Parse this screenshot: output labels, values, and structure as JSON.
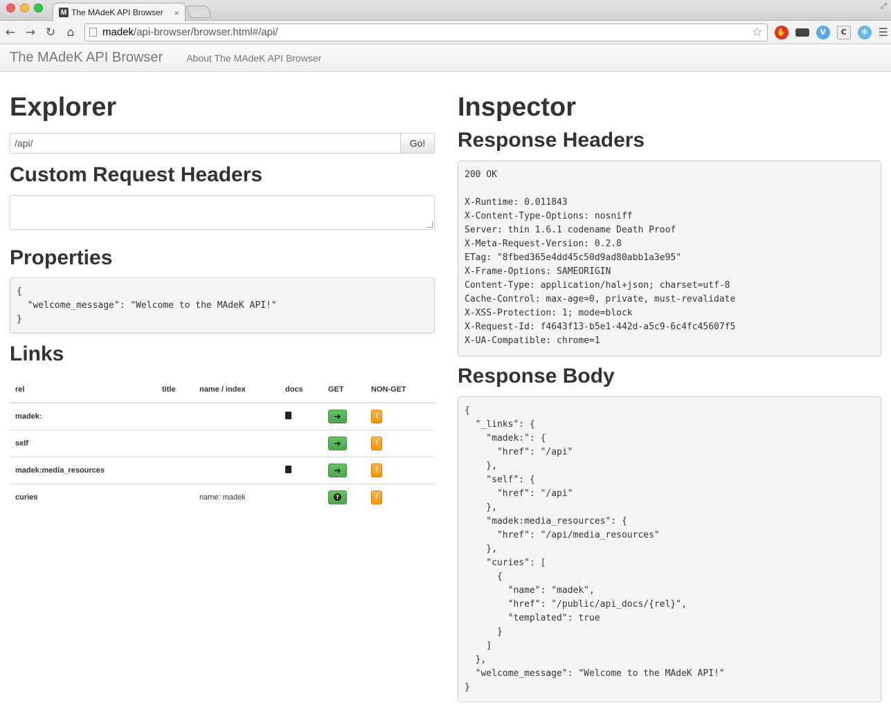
{
  "browser": {
    "tab_title": "The MAdeK API Browser",
    "tab_favicon": "M",
    "tab_close": "×",
    "url_host": "madek",
    "url_path": "/api-browser/browser.html#/api/"
  },
  "navbar": {
    "brand": "The MAdeK API Browser",
    "about_link": "About The MAdeK API Browser"
  },
  "explorer": {
    "title": "Explorer",
    "url_value": "/api/",
    "go_label": "Go!",
    "custom_headers_title": "Custom Request Headers",
    "custom_headers_value": "",
    "properties_title": "Properties",
    "properties_json": "{\n  \"welcome_message\": \"Welcome to the MAdeK API!\"\n}",
    "links_title": "Links",
    "links_table": {
      "headers": [
        "rel",
        "title",
        "name / index",
        "docs",
        "GET",
        "NON-GET"
      ],
      "rows": [
        {
          "rel": "madek:",
          "title": "",
          "name": "",
          "docs": true,
          "get_icon": "arrow-right-icon",
          "nonget_icon": "exclamation-icon"
        },
        {
          "rel": "self",
          "title": "",
          "name": "",
          "docs": false,
          "get_icon": "arrow-right-icon",
          "nonget_icon": "exclamation-icon"
        },
        {
          "rel": "madek:media_resources",
          "title": "",
          "name": "",
          "docs": true,
          "get_icon": "arrow-right-icon",
          "nonget_icon": "exclamation-icon"
        },
        {
          "rel": "curies",
          "title": "",
          "name": "name: madek",
          "docs": false,
          "get_icon": "question-icon",
          "nonget_icon": "exclamation-icon"
        }
      ]
    }
  },
  "inspector": {
    "title": "Inspector",
    "response_headers_title": "Response Headers",
    "response_headers": "200 OK\n\nX-Runtime: 0.011843\nX-Content-Type-Options: nosniff\nServer: thin 1.6.1 codename Death Proof\nX-Meta-Request-Version: 0.2.8\nETag: \"8fbed365e4dd45c50d9ad80abb1a3e95\"\nX-Frame-Options: SAMEORIGIN\nContent-Type: application/hal+json; charset=utf-8\nCache-Control: max-age=0, private, must-revalidate\nX-XSS-Protection: 1; mode=block\nX-Request-Id: f4643f13-b5e1-442d-a5c9-6c4fc45607f5\nX-UA-Compatible: chrome=1",
    "response_body_title": "Response Body",
    "response_body": "{\n  \"_links\": {\n    \"madek:\": {\n      \"href\": \"/api\"\n    },\n    \"self\": {\n      \"href\": \"/api\"\n    },\n    \"madek:media_resources\": {\n      \"href\": \"/api/media_resources\"\n    },\n    \"curies\": [\n      {\n        \"name\": \"madek\",\n        \"href\": \"/public/api_docs/{rel}\",\n        \"templated\": true\n      }\n    ]\n  },\n  \"welcome_message\": \"Welcome to the MAdeK API!\"\n}"
  }
}
